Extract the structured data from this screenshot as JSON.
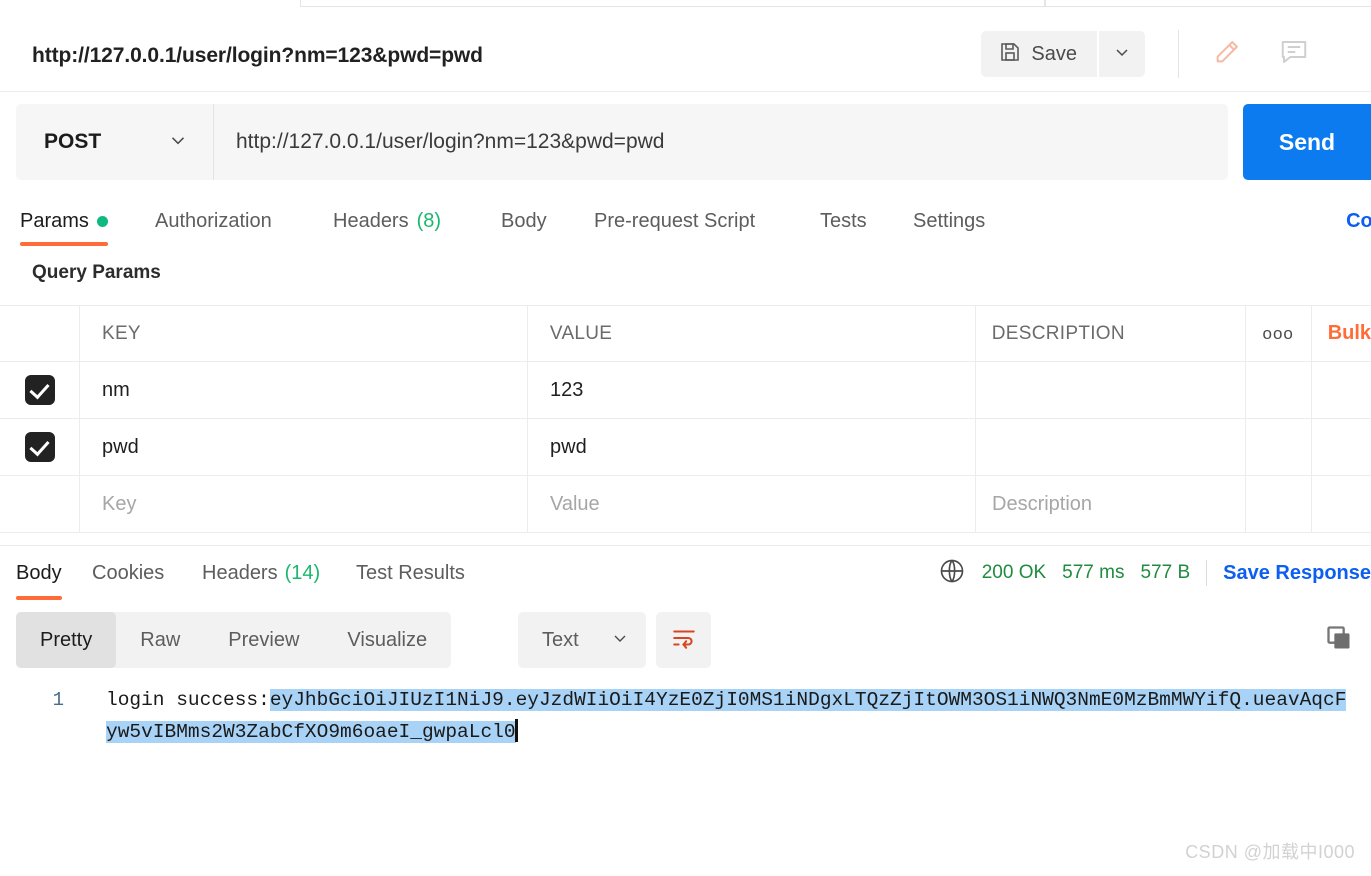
{
  "request": {
    "title": "http://127.0.0.1/user/login?nm=123&pwd=pwd",
    "method": "POST",
    "url": "http://127.0.0.1/user/login?nm=123&pwd=pwd",
    "save_label": "Save",
    "send_label": "Send"
  },
  "request_tabs": [
    {
      "label": "Params",
      "badge": "",
      "active": true,
      "has_dot": true
    },
    {
      "label": "Authorization",
      "badge": "",
      "active": false,
      "has_dot": false
    },
    {
      "label": "Headers",
      "badge": "(8)",
      "active": false,
      "has_dot": false
    },
    {
      "label": "Body",
      "badge": "",
      "active": false,
      "has_dot": false
    },
    {
      "label": "Pre-request Script",
      "badge": "",
      "active": false,
      "has_dot": false
    },
    {
      "label": "Tests",
      "badge": "",
      "active": false,
      "has_dot": false
    },
    {
      "label": "Settings",
      "badge": "",
      "active": false,
      "has_dot": false
    }
  ],
  "cookies_link": "Coo",
  "params": {
    "section_label": "Query Params",
    "columns": [
      "KEY",
      "VALUE",
      "DESCRIPTION"
    ],
    "menu_icon": "ooo",
    "bulk_edit_label": "Bulk",
    "rows": [
      {
        "checked": true,
        "key": "nm",
        "value": "123",
        "description": ""
      },
      {
        "checked": true,
        "key": "pwd",
        "value": "pwd",
        "description": ""
      }
    ],
    "placeholders": {
      "key": "Key",
      "value": "Value",
      "description": "Description"
    }
  },
  "response": {
    "tabs": [
      {
        "label": "Body",
        "badge": "",
        "active": true
      },
      {
        "label": "Cookies",
        "badge": "",
        "active": false
      },
      {
        "label": "Headers",
        "badge": "(14)",
        "active": false
      },
      {
        "label": "Test Results",
        "badge": "",
        "active": false
      }
    ],
    "status": "200 OK",
    "time": "577 ms",
    "size": "577 B",
    "save_response_label": "Save Response",
    "view_modes": [
      {
        "label": "Pretty",
        "active": true
      },
      {
        "label": "Raw",
        "active": false
      },
      {
        "label": "Preview",
        "active": false
      },
      {
        "label": "Visualize",
        "active": false
      }
    ],
    "format": "Text",
    "body": {
      "line_number": "1",
      "prefix": "login success:",
      "token": "eyJhbGciOiJIUzI1NiJ9.eyJzdWIiOiI4YzE0ZjI0MS1iNDgxLTQzZjItOWM3OS1iNWQ3NmE0MzBmMWYifQ.ueavAqcFyw5vIBMms2W3ZabCfXO9m6oaeI_gwpaLcl0"
    }
  },
  "watermark": "CSDN @加载中I000",
  "colors": {
    "accent_orange": "#ff6c37",
    "send_blue": "#0c7bf0",
    "link_blue": "#0c5ff0",
    "status_green": "#1f8b3f",
    "selection_blue": "#a8d3f7"
  }
}
